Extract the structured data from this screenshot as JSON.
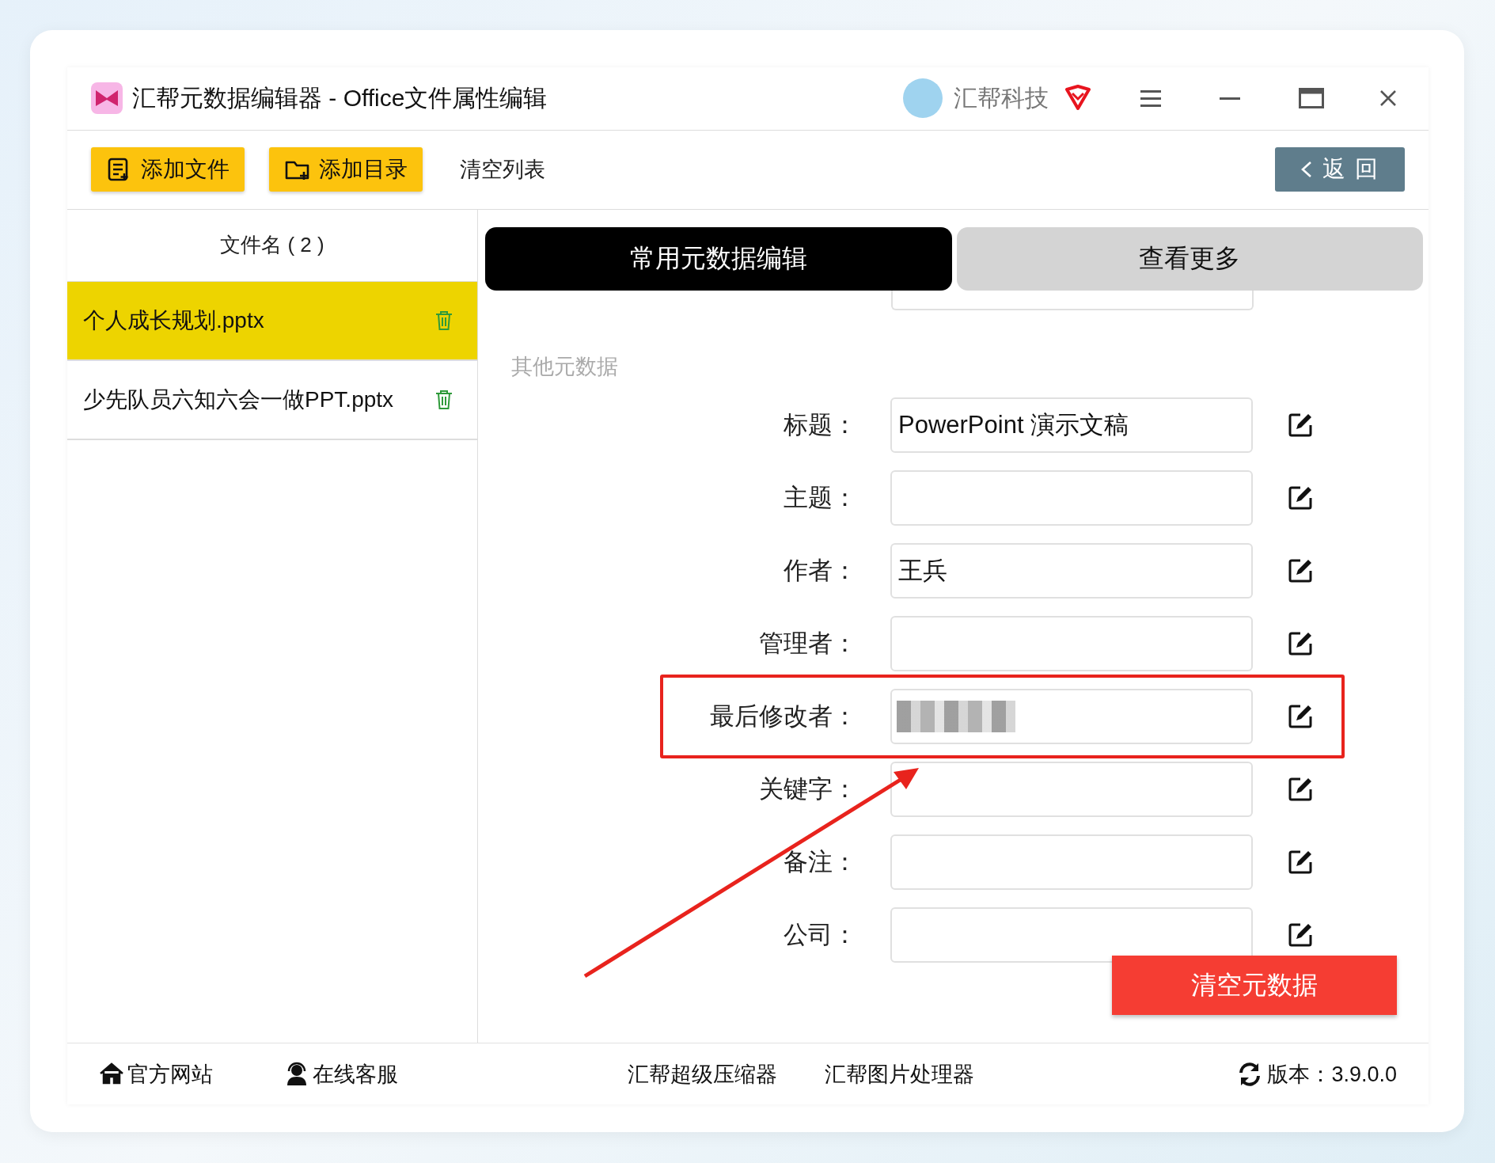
{
  "window": {
    "title": "汇帮元数据编辑器 - Office文件属性编辑",
    "user_name": "汇帮科技"
  },
  "toolbar": {
    "buttons": [
      {
        "label": "添加文件",
        "kind": "file"
      },
      {
        "label": "添加目录",
        "kind": "folder"
      }
    ],
    "clear_list": "清空列表",
    "back": "返 回"
  },
  "file_list": {
    "header": "文件名 ( 2 )",
    "files": [
      {
        "name": "个人成长规划.pptx",
        "selected": true
      },
      {
        "name": "少先队员六知六会一做PPT.pptx",
        "selected": false
      }
    ]
  },
  "tabs": [
    {
      "label": "常用元数据编辑",
      "selected": true
    },
    {
      "label": "查看更多",
      "selected": false
    }
  ],
  "section_title": "其他元数据",
  "fields": [
    {
      "label": "标题：",
      "kind": "text",
      "value": "PowerPoint 演示文稿",
      "highlighted": false
    },
    {
      "label": "主题：",
      "kind": "text",
      "highlighted": false
    },
    {
      "label": "作者：",
      "kind": "text",
      "value": "王兵",
      "highlighted": false
    },
    {
      "label": "管理者：",
      "kind": "text",
      "highlighted": false
    },
    {
      "label": "最后修改者：",
      "kind": "blurred",
      "highlighted": true
    },
    {
      "label": "关键字：",
      "kind": "text",
      "highlighted": false
    },
    {
      "label": "备注：",
      "kind": "text",
      "highlighted": false
    },
    {
      "label": "公司：",
      "kind": "text",
      "highlighted": false
    }
  ],
  "clear_button": "清空元数据",
  "footer": {
    "links": [
      {
        "label": "官方网站",
        "kind": "home"
      },
      {
        "label": "在线客服",
        "kind": "support"
      },
      {
        "label": "汇帮超级压缩器",
        "kind": "plain"
      },
      {
        "label": "汇帮图片处理器",
        "kind": "plain"
      }
    ],
    "version": "版本：3.9.0.0"
  }
}
